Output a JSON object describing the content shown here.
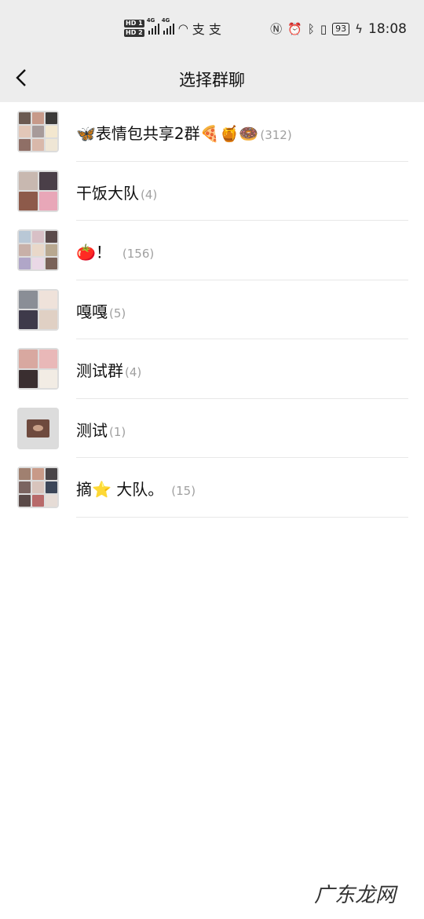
{
  "status_bar": {
    "hd1": "HD 1",
    "hd2": "HD 2",
    "net1": "4G",
    "net2": "4G",
    "app_icons": "支 支",
    "battery": "93",
    "time": "18:08",
    "icons": [
      "nfc-icon",
      "alarm-icon",
      "bluetooth-icon",
      "vibrate-icon",
      "charging-icon"
    ]
  },
  "header": {
    "title": "选择群聊",
    "back_icon": "chevron-left-icon"
  },
  "groups": [
    {
      "name": "🦋表情包共享2群🍕🍯🍩",
      "count": "(312)"
    },
    {
      "name": "干饭大队",
      "count": "(4)"
    },
    {
      "name": "🍅！",
      "count": "(156)"
    },
    {
      "name": "嘎嘎",
      "count": "(5)"
    },
    {
      "name": "测试群",
      "count": "(4)"
    },
    {
      "name": "测试",
      "count": "(1)"
    },
    {
      "name": "摘⭐ 大队。",
      "count": "(15)"
    }
  ],
  "watermark": "广东龙网"
}
